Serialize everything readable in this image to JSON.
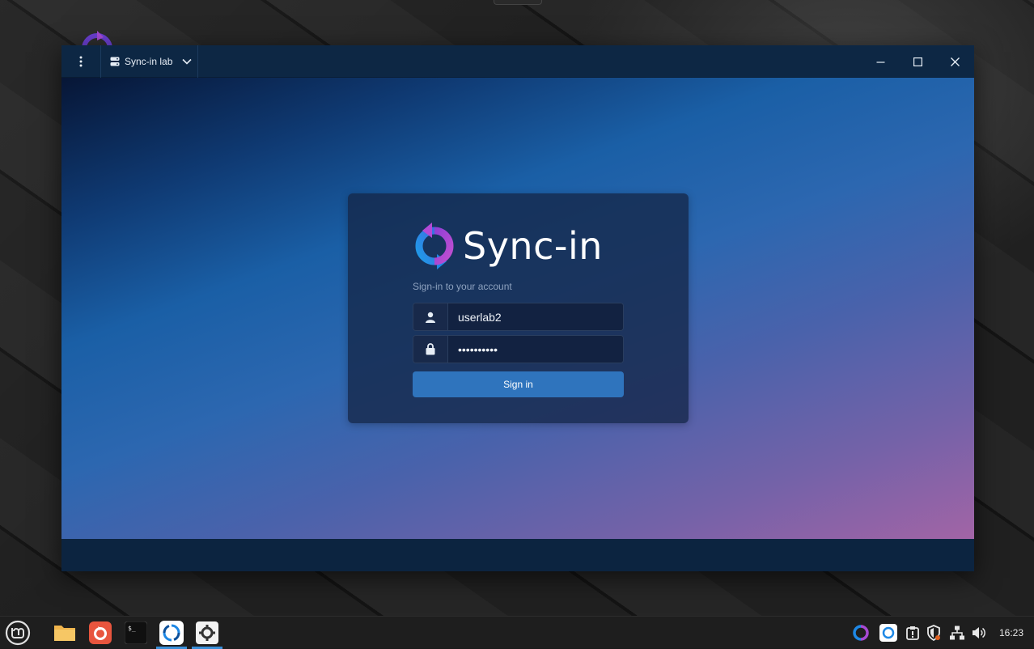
{
  "window": {
    "server_name": "Sync-in lab"
  },
  "login": {
    "brand": "Sync-in",
    "subtitle": "Sign-in to your account",
    "username_value": "userlab2",
    "password_value": "••••••••••",
    "submit_label": "Sign in"
  },
  "taskbar": {
    "clock": "16:23",
    "apps": [
      {
        "name": "menu",
        "icon": "linux-mint-menu-icon"
      },
      {
        "name": "files",
        "icon": "folder-icon"
      },
      {
        "name": "browser",
        "icon": "firefox-icon"
      },
      {
        "name": "terminal",
        "icon": "terminal-icon"
      },
      {
        "name": "sync-in",
        "icon": "sync-in-icon"
      },
      {
        "name": "settings",
        "icon": "gear-icon"
      }
    ]
  },
  "colors": {
    "accent": "#2f74bd",
    "brand_blue": "#1e88e5",
    "brand_purple": "#b34ad6"
  }
}
